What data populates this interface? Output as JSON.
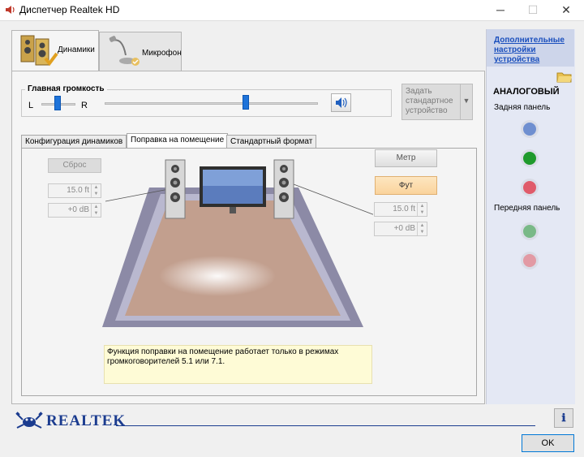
{
  "window": {
    "title": "Диспетчер Realtek HD"
  },
  "device_tabs": [
    {
      "label": "Динамики",
      "active": true
    },
    {
      "label": "Микрофон",
      "active": false
    }
  ],
  "volume": {
    "title": "Главная громкость",
    "left_label": "L",
    "right_label": "R",
    "balance": 0.5,
    "level": 0.7
  },
  "default_device_button": {
    "label": "Задать стандартное устройство"
  },
  "inner_tabs": [
    {
      "label": "Конфигурация динамиков",
      "active": false
    },
    {
      "label": "Поправка на помещение",
      "active": true
    },
    {
      "label": "Стандартный формат",
      "active": false
    }
  ],
  "room_correction": {
    "reset_label": "Сброс",
    "left_distance": "15.0 ft",
    "left_gain": "+0 dB",
    "right_distance": "15.0 ft",
    "right_gain": "+0 dB",
    "unit_meter": "Метр",
    "unit_feet": "Фут",
    "info_text": "Функция поправки на помещение работает только в режимах громкоговорителей 5.1 или 7.1."
  },
  "side_panel": {
    "link": "Дополнительные настройки устройства",
    "header": "АНАЛОГОВЫЙ",
    "rear_label": "Задняя панель",
    "front_label": "Передняя панель",
    "rear_jacks": [
      "#6f8fd0",
      "#1f9a2c",
      "#e05b6a"
    ],
    "front_jacks": [
      "#79b987",
      "#e29aa4"
    ]
  },
  "footer": {
    "brand": "REALTEK",
    "info_icon": "info-icon",
    "ok_label": "OK"
  }
}
